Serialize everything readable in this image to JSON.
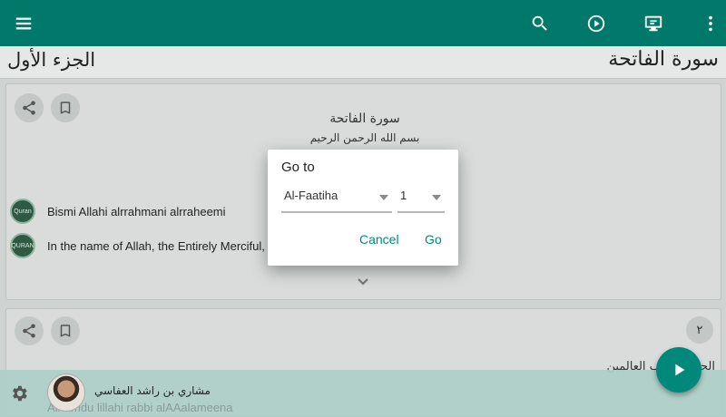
{
  "toolbar": {
    "icons": [
      "menu-icon",
      "search-icon",
      "play-circle-icon",
      "screen-share-icon",
      "more-vert-icon"
    ],
    "color": "#00796b"
  },
  "header": {
    "juz": "الجزء الأول",
    "surah": "سورة الفاتحة"
  },
  "card1": {
    "calligraphy_title": "سورة الفاتحة",
    "calligraphy_basmala": "بسم الله الرحمن الرحيم",
    "transliteration": "Bismi Allahi alrrahmani alrraheemi",
    "translation": "In the name of Allah, the Entirely Merciful,",
    "logo_text_1": "Quran",
    "logo_text_2": "QURAN"
  },
  "card2": {
    "ayah_number": "٢",
    "calligraphy": "الحمد لله رب العالمين",
    "transliteration_partial": "Alhamdu lillahi rabbi alAAalameena"
  },
  "player": {
    "reciter_name": "مشاري بن راشد العفاسي"
  },
  "dialog": {
    "title": "Go to",
    "surah_value": "Al-Faatiha",
    "ayah_value": "1",
    "cancel_label": "Cancel",
    "go_label": "Go",
    "accent": "#00897b"
  }
}
